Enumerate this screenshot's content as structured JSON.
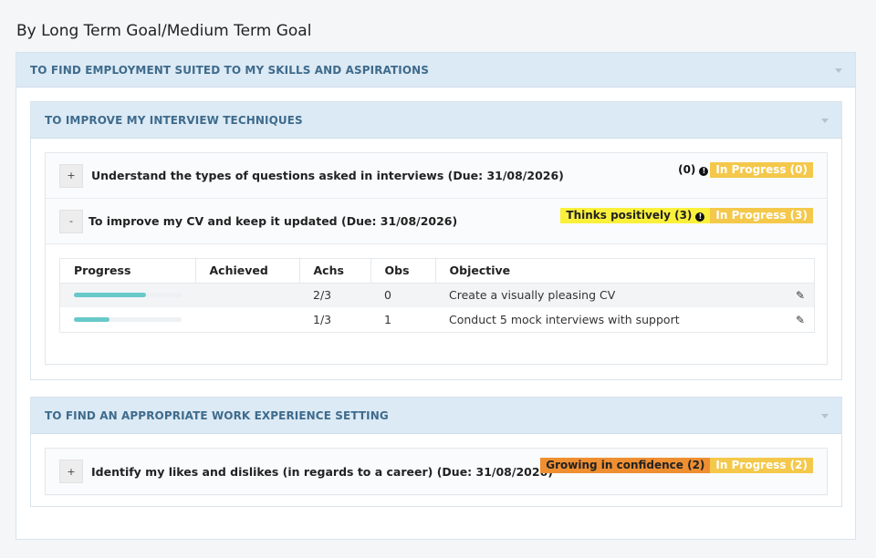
{
  "page_title": "By Long Term Goal/Medium Term Goal",
  "long_term_goal": {
    "title": "TO FIND EMPLOYMENT SUITED TO MY SKILLS AND ASPIRATIONS"
  },
  "medium_goals": [
    {
      "title": "TO IMPROVE MY INTERVIEW TECHNIQUES",
      "objectives": [
        {
          "toggle": "+",
          "title": "Understand the types of questions asked in interviews (Due: 31/08/2026)",
          "badge_count": "(0)",
          "status": "In Progress (0)"
        },
        {
          "toggle": "-",
          "title": "To improve my CV and keep it updated (Due: 31/08/2026)",
          "trait": "Thinks positively (3)",
          "status": "In Progress (3)",
          "table": {
            "headers": [
              "Progress",
              "Achieved",
              "Achs",
              "Obs",
              "Objective"
            ],
            "rows": [
              {
                "progress": 0.67,
                "achieved": "",
                "achs": "2/3",
                "obs": "0",
                "objective": "Create a visually pleasing CV"
              },
              {
                "progress": 0.33,
                "achieved": "",
                "achs": "1/3",
                "obs": "1",
                "objective": "Conduct 5 mock interviews with support"
              }
            ]
          }
        }
      ]
    },
    {
      "title": "TO FIND AN APPROPRIATE WORK EXPERIENCE SETTING",
      "objectives": [
        {
          "toggle": "+",
          "title": "Identify my likes and dislikes (in regards to a career) (Due: 31/08/2026)",
          "trait": "Growing in confidence (2)",
          "status": "In Progress (2)"
        }
      ]
    }
  ],
  "colors": {
    "header_bg": "#dceaf5",
    "header_text": "#3f6b8c",
    "progress_fill": "#68c9c9",
    "badge_yellow": "#faf03c",
    "badge_orange": "#ef8f32",
    "badge_gold": "#f4c84a"
  },
  "icons": {
    "collapse": "caret-down-icon",
    "edit": "pencil-icon",
    "alert": "exclamation-circle-icon"
  }
}
